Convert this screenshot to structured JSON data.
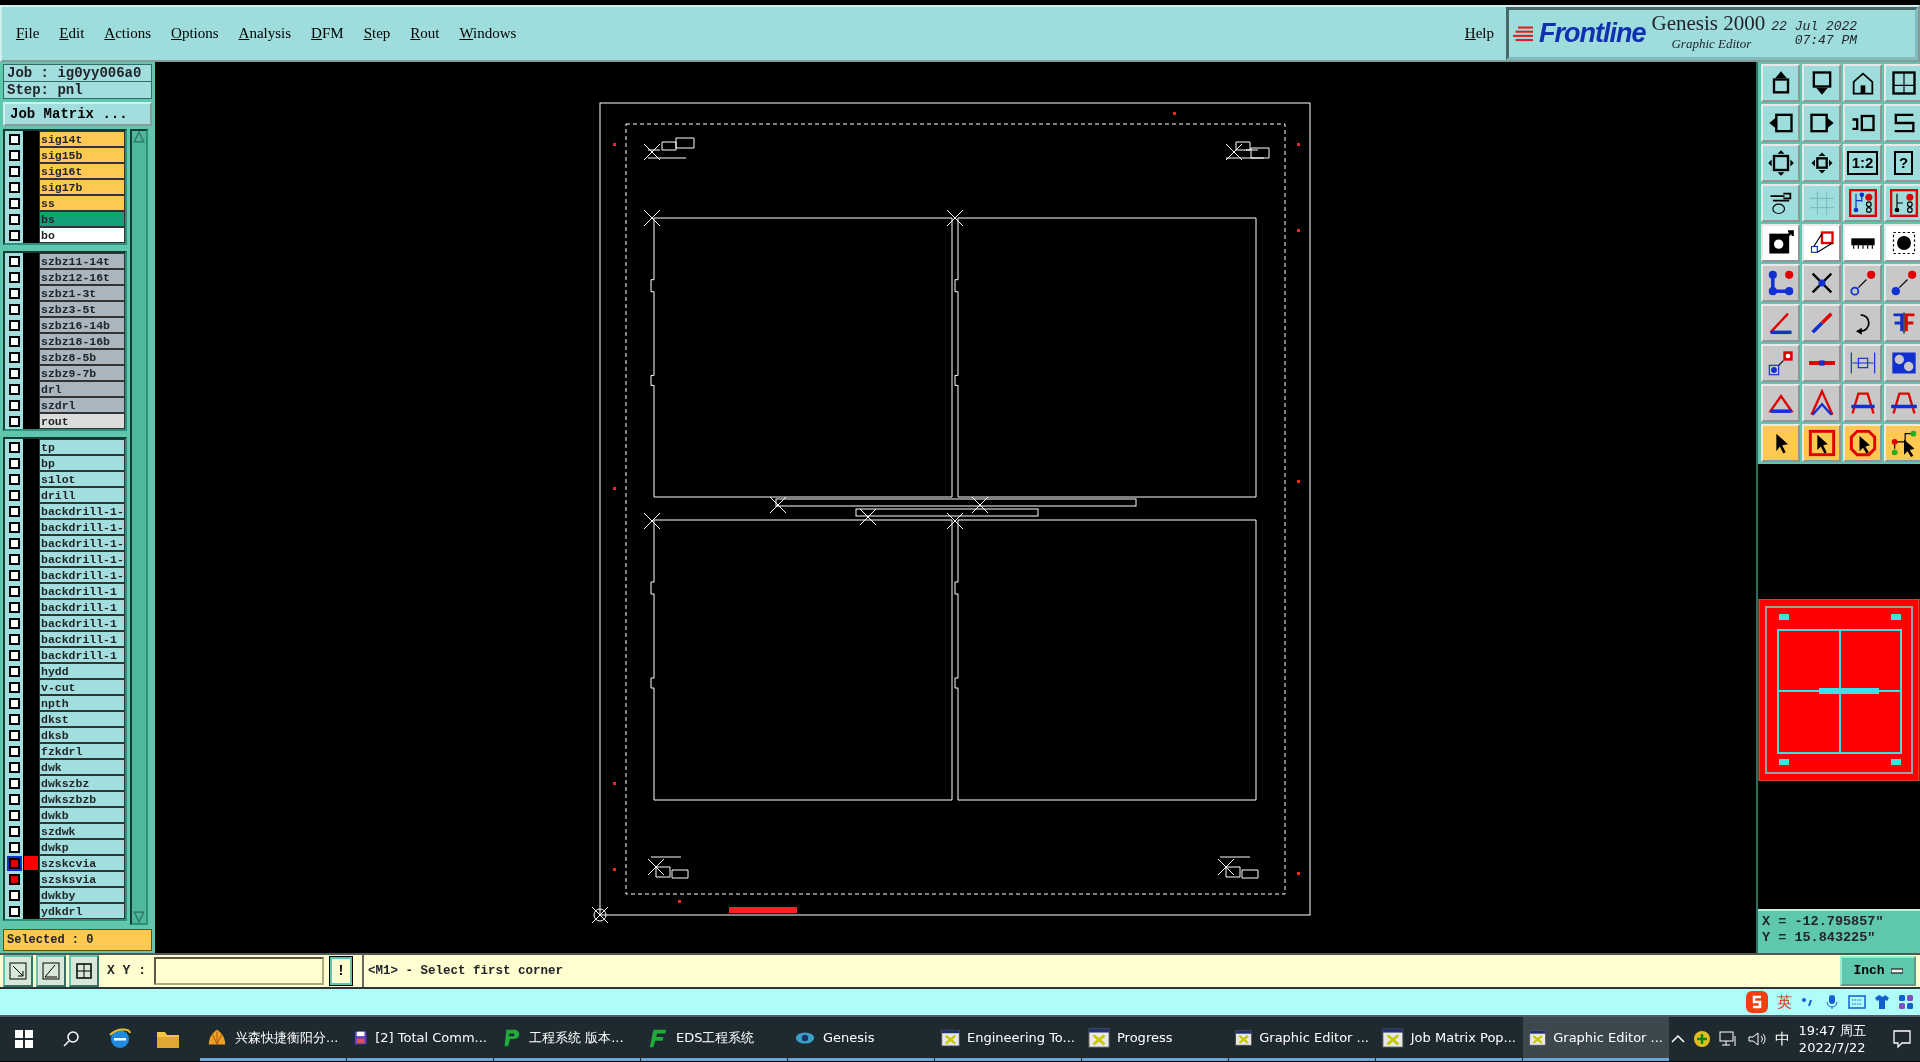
{
  "menu": [
    {
      "label": "File"
    },
    {
      "label": "Edit"
    },
    {
      "label": "Actions"
    },
    {
      "label": "Options"
    },
    {
      "label": "Analysis"
    },
    {
      "label": "DFM"
    },
    {
      "label": "Step"
    },
    {
      "label": "Rout"
    },
    {
      "label": "Windows"
    }
  ],
  "help": "Help",
  "brand": {
    "logo": "Frontline",
    "product": "Genesis 2000",
    "subtitle": "Graphic Editor",
    "date": "22 Jul 2022",
    "time": "07:47 PM"
  },
  "job": {
    "job": "Job : ig0yy006a0",
    "step": "Step: pnl",
    "matrix_button": "Job Matrix ..."
  },
  "layer_groups": [
    [
      {
        "name": "sig14t",
        "color": "#ffc850",
        "displayed": false,
        "work": false
      },
      {
        "name": "sig15b",
        "color": "#ffc850",
        "displayed": false,
        "work": false
      },
      {
        "name": "sig16t",
        "color": "#ffc850",
        "displayed": false,
        "work": false
      },
      {
        "name": "sig17b",
        "color": "#ffc850",
        "displayed": false,
        "work": false
      },
      {
        "name": "ss",
        "color": "#ffc850",
        "displayed": false,
        "work": false
      },
      {
        "name": "bs",
        "color": "#15a07c",
        "displayed": false,
        "work": false
      },
      {
        "name": "bo",
        "color": "#ffffff",
        "displayed": false,
        "work": false
      }
    ],
    [
      {
        "name": "szbz11-14t",
        "color": "#a9b6bf",
        "displayed": false,
        "work": false
      },
      {
        "name": "szbz12-16t",
        "color": "#a9b6bf",
        "displayed": false,
        "work": false
      },
      {
        "name": "szbz1-3t",
        "color": "#a9b6bf",
        "displayed": false,
        "work": false
      },
      {
        "name": "szbz3-5t",
        "color": "#a9b6bf",
        "displayed": false,
        "work": false
      },
      {
        "name": "szbz16-14b",
        "color": "#a9b6bf",
        "displayed": false,
        "work": false
      },
      {
        "name": "szbz18-16b",
        "color": "#a9b6bf",
        "displayed": false,
        "work": false
      },
      {
        "name": "szbz8-5b",
        "color": "#a9b6bf",
        "displayed": false,
        "work": false
      },
      {
        "name": "szbz9-7b",
        "color": "#a9b6bf",
        "displayed": false,
        "work": false
      },
      {
        "name": "drl",
        "color": "#a9b6bf",
        "displayed": false,
        "work": false
      },
      {
        "name": "szdrl",
        "color": "#a9b6bf",
        "displayed": false,
        "work": false
      },
      {
        "name": "rout",
        "color": "#dcdcdc",
        "displayed": false,
        "work": false
      }
    ],
    [
      {
        "name": "tp",
        "color": "#a3dede",
        "displayed": false,
        "work": false
      },
      {
        "name": "bp",
        "color": "#a3dede",
        "displayed": false,
        "work": false
      },
      {
        "name": "s1lot",
        "color": "#a3dede",
        "displayed": false,
        "work": false
      },
      {
        "name": "drill",
        "color": "#a3dede",
        "displayed": false,
        "work": false
      },
      {
        "name": "backdrill-1-",
        "color": "#a3dede",
        "displayed": false,
        "work": false
      },
      {
        "name": "backdrill-1-",
        "color": "#a3dede",
        "displayed": false,
        "work": false
      },
      {
        "name": "backdrill-1-",
        "color": "#a3dede",
        "displayed": false,
        "work": false
      },
      {
        "name": "backdrill-1-",
        "color": "#a3dede",
        "displayed": false,
        "work": false
      },
      {
        "name": "backdrill-1-",
        "color": "#a3dede",
        "displayed": false,
        "work": false
      },
      {
        "name": "backdrill-1",
        "color": "#a3dede",
        "displayed": false,
        "work": false
      },
      {
        "name": "backdrill-1",
        "color": "#a3dede",
        "displayed": false,
        "work": false
      },
      {
        "name": "backdrill-1",
        "color": "#a3dede",
        "displayed": false,
        "work": false
      },
      {
        "name": "backdrill-1",
        "color": "#a3dede",
        "displayed": false,
        "work": false
      },
      {
        "name": "backdrill-1",
        "color": "#a3dede",
        "displayed": false,
        "work": false
      },
      {
        "name": "hydd",
        "color": "#a3dede",
        "displayed": false,
        "work": false
      },
      {
        "name": "v-cut",
        "color": "#a3dede",
        "displayed": false,
        "work": false
      },
      {
        "name": "npth",
        "color": "#a3dede",
        "displayed": false,
        "work": false
      },
      {
        "name": "dkst",
        "color": "#a3dede",
        "displayed": false,
        "work": false
      },
      {
        "name": "dksb",
        "color": "#a3dede",
        "displayed": false,
        "work": false
      },
      {
        "name": "fzkdrl",
        "color": "#a3dede",
        "displayed": false,
        "work": false
      },
      {
        "name": "dwk",
        "color": "#a3dede",
        "displayed": false,
        "work": false
      },
      {
        "name": "dwkszbz",
        "color": "#a3dede",
        "displayed": false,
        "work": false
      },
      {
        "name": "dwkszbzb",
        "color": "#a3dede",
        "displayed": false,
        "work": false
      },
      {
        "name": "dwkb",
        "color": "#a3dede",
        "displayed": false,
        "work": false
      },
      {
        "name": "szdwk",
        "color": "#a3dede",
        "displayed": false,
        "work": false
      },
      {
        "name": "dwkp",
        "color": "#a3dede",
        "displayed": false,
        "work": false
      },
      {
        "name": "szskcvia",
        "color": "#a3dede",
        "displayed": true,
        "work": true
      },
      {
        "name": "szsksvia",
        "color": "#a3dede",
        "displayed": true,
        "work": false
      },
      {
        "name": "dwkby",
        "color": "#a3dede",
        "displayed": false,
        "work": false
      },
      {
        "name": "ydkdrl",
        "color": "#a3dede",
        "displayed": false,
        "work": false
      }
    ]
  ],
  "selected": "Selected : 0",
  "tool_texts": {
    "scale": "1:2",
    "help": "?"
  },
  "coordinates": {
    "x": "X = -12.795857\"",
    "y": "Y = 15.843225\""
  },
  "command": {
    "xy_label": "X Y :",
    "alert": "!",
    "prompt": "<M1> - Select first corner",
    "units": "Inch"
  },
  "ime": {
    "language": "英"
  },
  "taskbar": {
    "items": [
      {
        "label": "兴森快捷衡阳分...",
        "kind": "shell",
        "selected": false
      },
      {
        "label": "[2] Total Comm...",
        "kind": "disk",
        "selected": false
      },
      {
        "label": "工程系统   版本...",
        "kind": "pgreen",
        "selected": false
      },
      {
        "label": "EDS工程系统",
        "kind": "fgreen",
        "selected": false
      },
      {
        "label": "Genesis",
        "kind": "eye",
        "selected": false
      },
      {
        "label": "Engineering To...",
        "kind": "xwin",
        "selected": false
      },
      {
        "label": "Progress",
        "kind": "xwin",
        "selected": false
      },
      {
        "label": "Graphic Editor ...",
        "kind": "xwin",
        "selected": false
      },
      {
        "label": "Job Matrix Pop...",
        "kind": "xwin",
        "selected": false
      },
      {
        "label": "Graphic Editor ...",
        "kind": "xwin",
        "selected": true
      }
    ],
    "input_lang": "中",
    "time": "19:47 周五",
    "date": "2022/7/22"
  }
}
